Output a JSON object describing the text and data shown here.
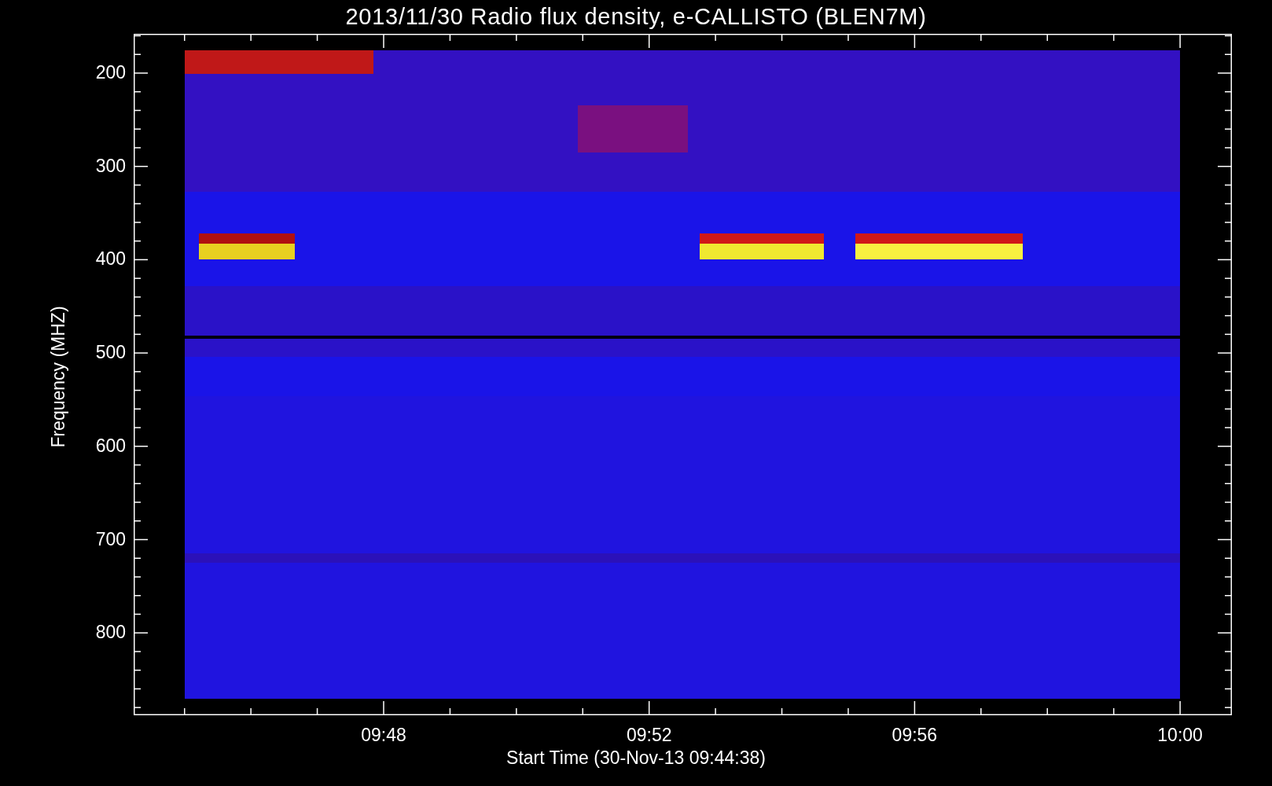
{
  "title": "2013/11/30  Radio flux density, e-CALLISTO (BLEN7M)",
  "y_axis": {
    "label": "Frequency (MHZ)",
    "ticks": [
      "200",
      "300",
      "400",
      "500",
      "600",
      "700",
      "800"
    ]
  },
  "x_axis": {
    "label": "Start Time (30-Nov-13 09:44:38)",
    "ticks": [
      "09:48",
      "09:52",
      "09:56",
      "10:00"
    ]
  }
}
